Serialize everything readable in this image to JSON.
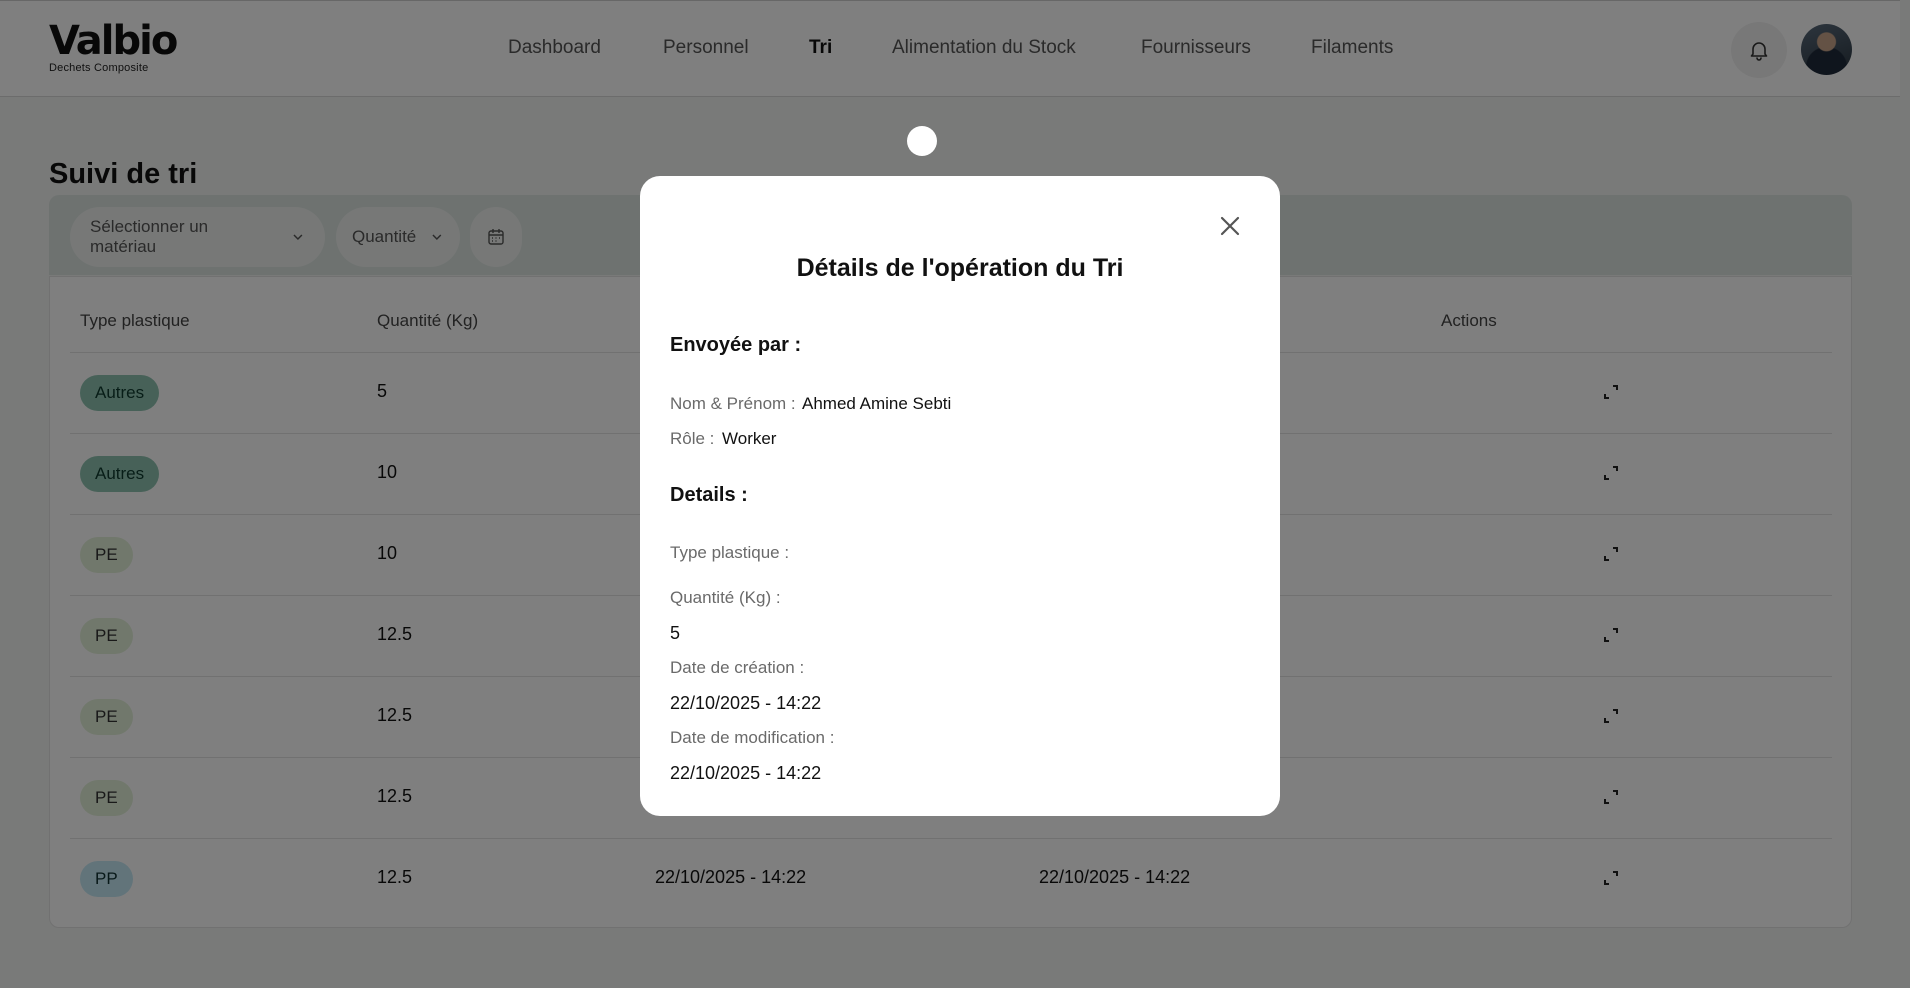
{
  "brand": {
    "name": "Valbio",
    "tagline": "Dechets Composite"
  },
  "nav": {
    "items": [
      "Dashboard",
      "Personnel",
      "Tri",
      "Alimentation du Stock",
      "Fournisseurs",
      "Filaments"
    ],
    "active": "Tri"
  },
  "header_icons": [
    "bell-icon",
    "avatar"
  ],
  "page": {
    "title": "Suivi de tri"
  },
  "filters": {
    "material_placeholder": "Sélectionner un matériau",
    "quantity_label": "Quantité",
    "calendar_icon": "calendar-icon"
  },
  "table": {
    "columns": [
      "Type plastique",
      "Quantité (Kg)",
      "Actions"
    ],
    "rows": [
      {
        "type": "Autres",
        "quantity": "5"
      },
      {
        "type": "Autres",
        "quantity": "10"
      },
      {
        "type": "PE",
        "quantity": "10"
      },
      {
        "type": "PE",
        "quantity": "12.5"
      },
      {
        "type": "PE",
        "quantity": "12.5"
      },
      {
        "type": "PE",
        "quantity": "12.5"
      },
      {
        "type": "PP",
        "quantity": "12.5",
        "created": "22/10/2025 - 14:22",
        "modified": "22/10/2025 - 14:22"
      }
    ],
    "action_icon": "expand-icon"
  },
  "badge_colors": {
    "Autres": "#8fc3b1",
    "PE": "#e3f1d9",
    "PP": "#c4e8f5"
  },
  "modal": {
    "title": "Détails de l'opération du Tri",
    "sent_by_heading": "Envoyée par :",
    "name_label": "Nom & Prénom :",
    "name_value": "Ahmed Amine Sebti",
    "role_label": "Rôle :",
    "role_value": "Worker",
    "details_heading": "Details :",
    "type_label": "Type plastique :",
    "quantity_label": "Quantité (Kg) :",
    "quantity_value": "5",
    "created_label": "Date de création :",
    "created_value": "22/10/2025 - 14:22",
    "modified_label": "Date de modification :",
    "modified_value": "22/10/2025 - 14:22"
  }
}
